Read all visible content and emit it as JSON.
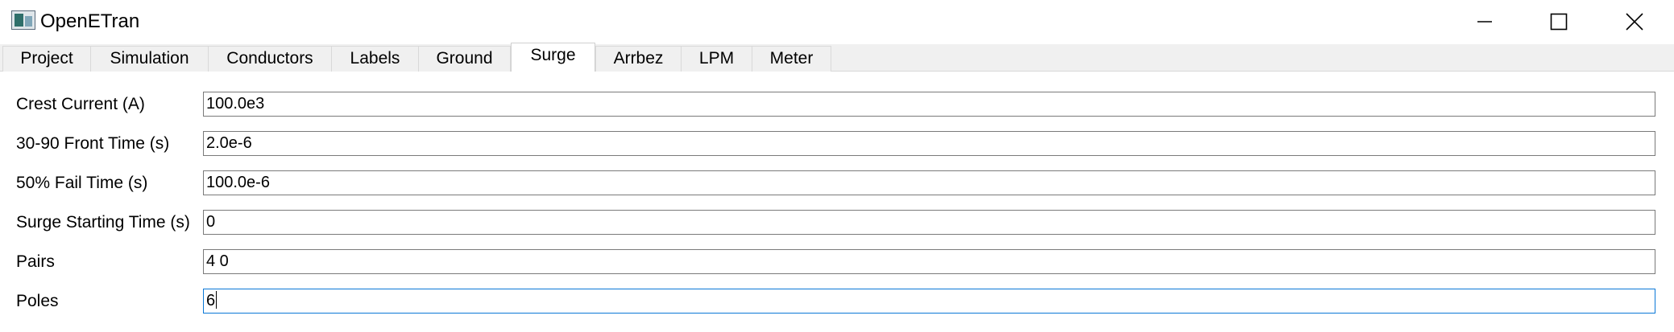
{
  "window": {
    "title": "OpenETran",
    "icon": "app-icon",
    "controls": [
      "minimize-icon",
      "maximize-icon",
      "close-icon"
    ]
  },
  "tabs": [
    {
      "label": "Project"
    },
    {
      "label": "Simulation"
    },
    {
      "label": "Conductors"
    },
    {
      "label": "Labels"
    },
    {
      "label": "Ground"
    },
    {
      "label": "Surge",
      "active": true
    },
    {
      "label": "Arrbez"
    },
    {
      "label": "LPM"
    },
    {
      "label": "Meter"
    }
  ],
  "form": {
    "crest_current": {
      "label": "Crest Current (A)",
      "value": "100.0e3"
    },
    "front_time": {
      "label": "30-90 Front Time (s)",
      "value": "2.0e-6"
    },
    "fail_time": {
      "label": "50% Fail Time (s)",
      "value": "100.0e-6"
    },
    "start_time": {
      "label": "Surge Starting Time (s)",
      "value": "0"
    },
    "pairs": {
      "label": "Pairs",
      "value": "4 0"
    },
    "poles": {
      "label": "Poles",
      "value": "6"
    }
  },
  "colors": {
    "focus_border": "#0a78d7",
    "tabbar_bg": "#f0f0f0"
  }
}
